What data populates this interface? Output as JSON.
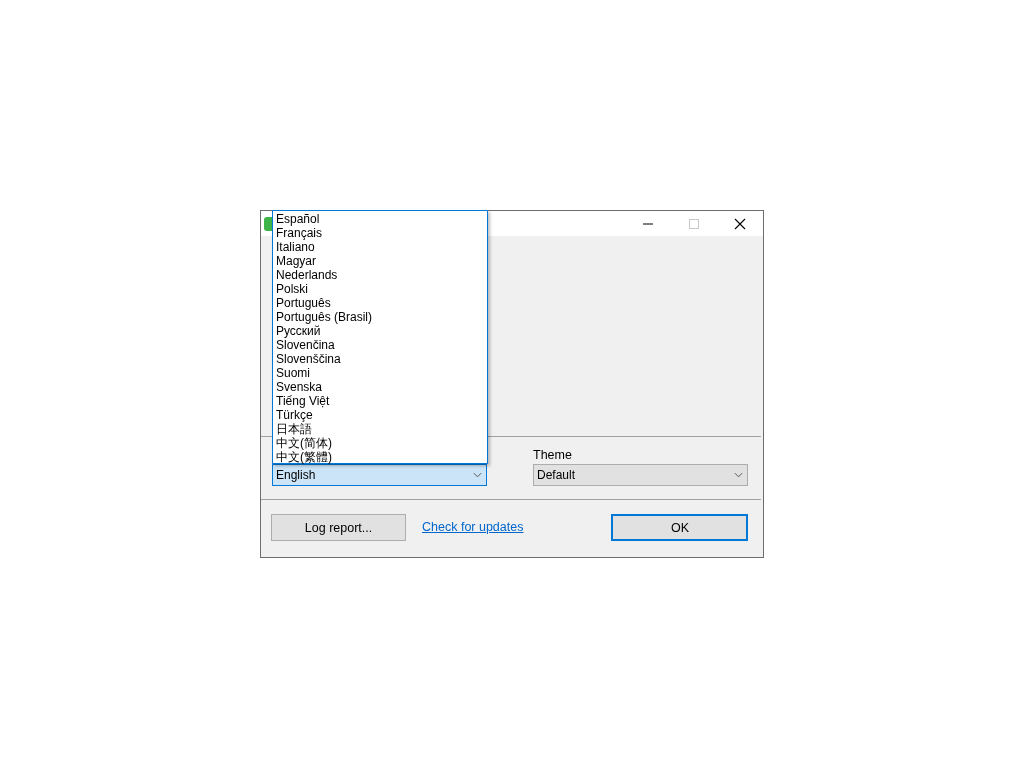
{
  "window": {
    "controls": [
      {
        "kind": "minimize"
      },
      {
        "kind": "maximize"
      },
      {
        "kind": "close"
      }
    ]
  },
  "language": {
    "value": "English",
    "list_open": true,
    "options": [
      {
        "label": "Español",
        "selected": false
      },
      {
        "label": "Français",
        "selected": false
      },
      {
        "label": "Italiano",
        "selected": false
      },
      {
        "label": "Magyar",
        "selected": false
      },
      {
        "label": "Nederlands",
        "selected": false
      },
      {
        "label": "Polski",
        "selected": false
      },
      {
        "label": "Português",
        "selected": false
      },
      {
        "label": "Português (Brasil)",
        "selected": false
      },
      {
        "label": "Русский",
        "selected": false
      },
      {
        "label": "Slovenčina",
        "selected": false
      },
      {
        "label": "Slovenščina",
        "selected": false
      },
      {
        "label": "Suomi",
        "selected": false
      },
      {
        "label": "Svenska",
        "selected": false
      },
      {
        "label": "Tiếng Việt",
        "selected": false
      },
      {
        "label": "Türkçe",
        "selected": false
      },
      {
        "label": "日本語",
        "selected": false
      },
      {
        "label": "中文(简体)",
        "selected": false
      },
      {
        "label": "中文(繁體)",
        "selected": false
      }
    ]
  },
  "theme": {
    "label": "Theme",
    "value": "Default"
  },
  "buttons": {
    "log_report": "Log report...",
    "check_updates": "Check for updates",
    "ok": "OK"
  }
}
